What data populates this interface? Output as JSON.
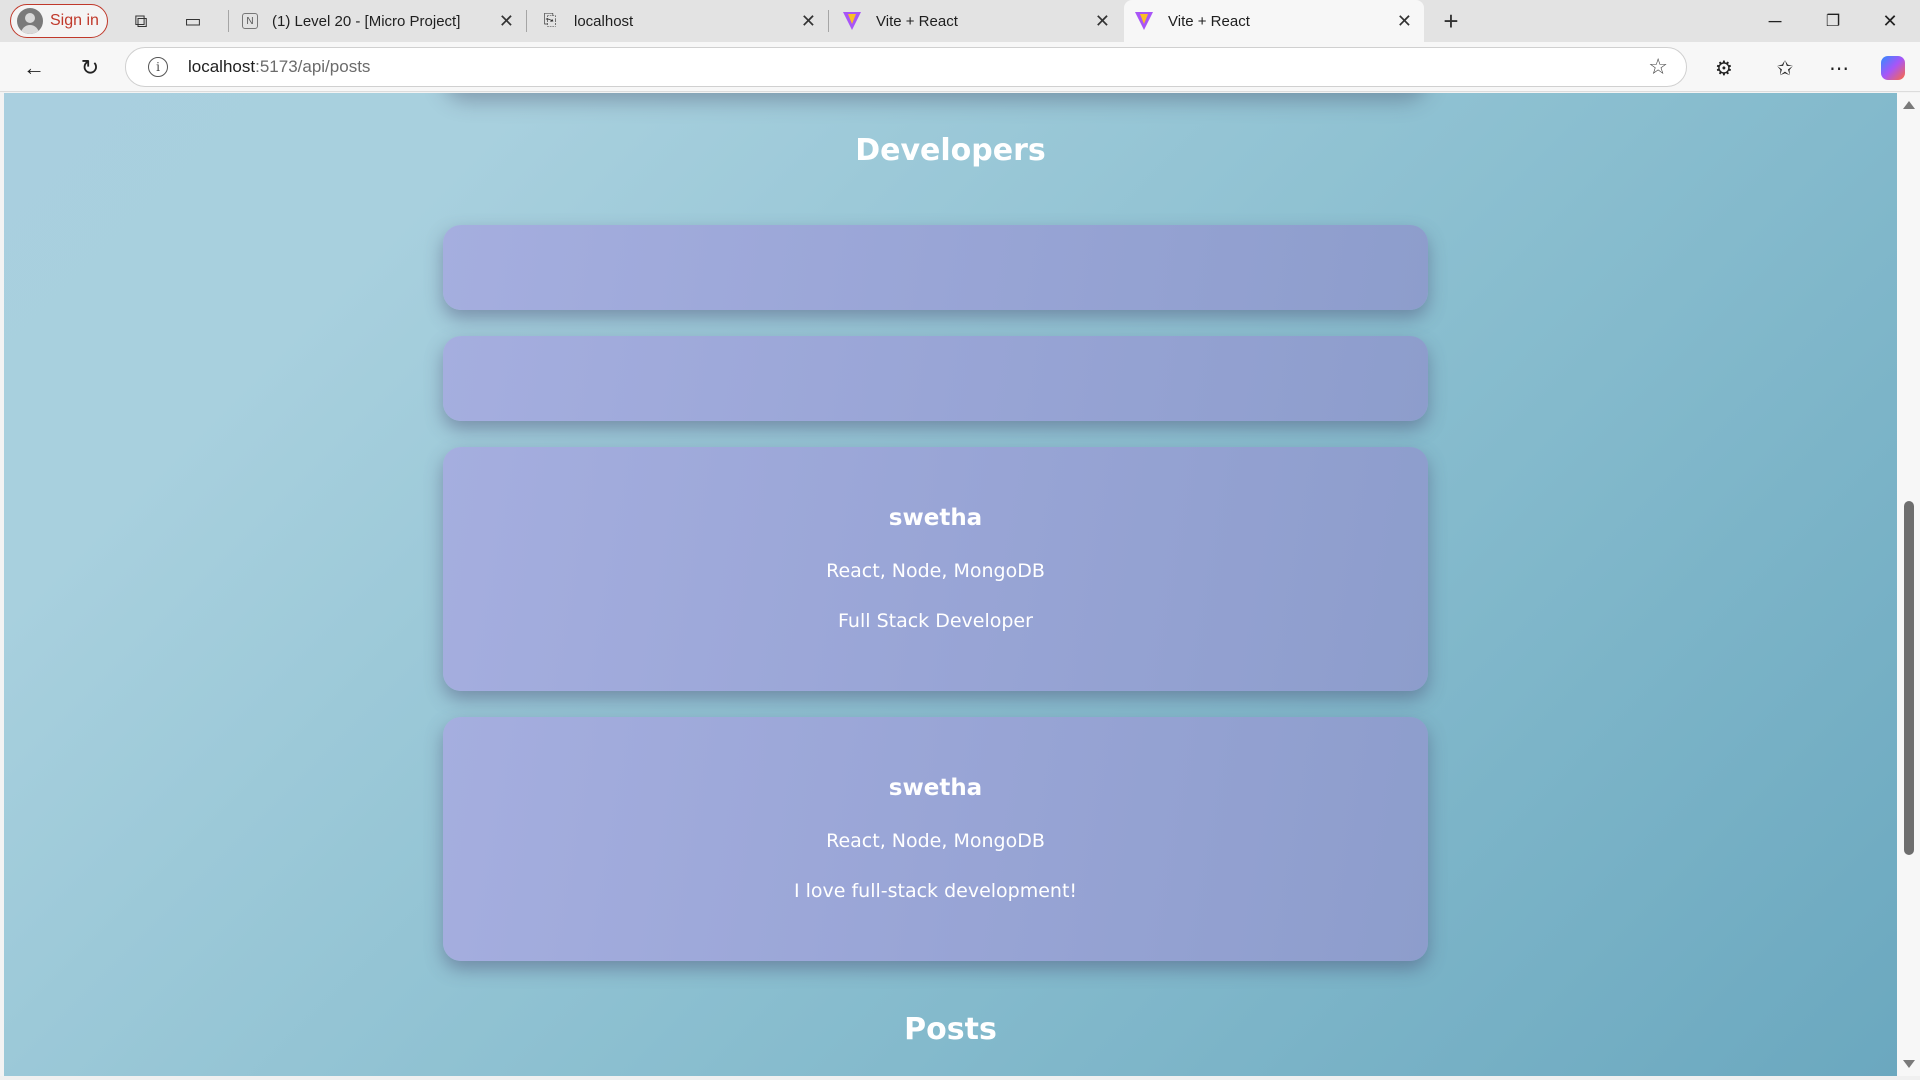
{
  "browser": {
    "signin_label": "Sign in",
    "tabs": [
      {
        "title": "(1) Level 20 - [Micro Project]",
        "icon": "notion-icon"
      },
      {
        "title": "localhost",
        "icon": "page-icon"
      },
      {
        "title": "Vite + React",
        "icon": "vite-icon"
      },
      {
        "title": "Vite + React",
        "icon": "vite-icon",
        "active": true
      }
    ],
    "address": {
      "host": "localhost",
      "path": ":5173/api/posts"
    }
  },
  "page": {
    "developers_heading": "Developers",
    "posts_heading": "Posts",
    "developers": [
      {
        "name": "",
        "skills": "",
        "bio": ""
      },
      {
        "name": "",
        "skills": "",
        "bio": ""
      },
      {
        "name": "swetha",
        "skills": "React, Node, MongoDB",
        "bio": "Full Stack Developer"
      },
      {
        "name": "swetha",
        "skills": "React, Node, MongoDB",
        "bio": "I love full-stack development!"
      }
    ]
  },
  "colors": {
    "background_start": "#a9cfdf",
    "background_end": "#6ba8bf",
    "card": "#99a5d6",
    "signin_accent": "#c0392b"
  }
}
